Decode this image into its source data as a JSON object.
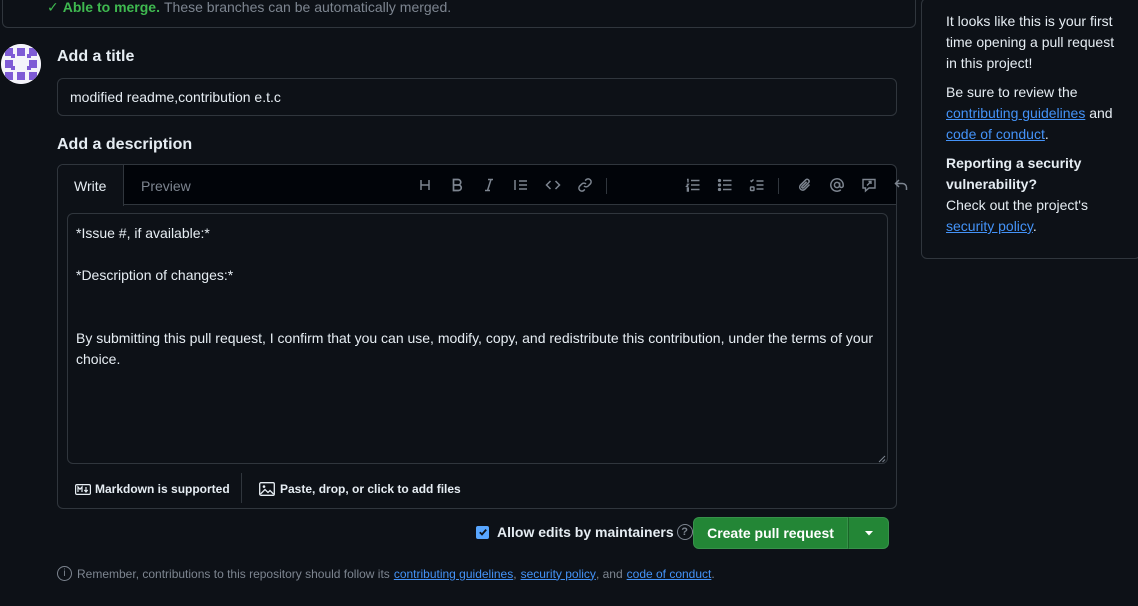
{
  "merge": {
    "status": "Able to merge.",
    "detail": "These branches can be automatically merged."
  },
  "form": {
    "title_label": "Add a title",
    "title_value": "modified readme,contribution e.t.c",
    "description_label": "Add a description"
  },
  "editor": {
    "tabs": [
      "Write",
      "Preview"
    ],
    "toolbar_icons": [
      "heading-icon",
      "bold-icon",
      "italic-icon",
      "quote-icon",
      "code-icon",
      "link-icon",
      "ordered-list-icon",
      "unordered-list-icon",
      "task-list-icon",
      "attach-icon",
      "mention-icon",
      "reference-icon",
      "undo-icon",
      "slash-command-icon"
    ],
    "body": "*Issue #, if available:*\n\n*Description of changes:*\n\n\nBy submitting this pull request, I confirm that you can use, modify, copy, and redistribute this contribution, under the terms of your choice.",
    "markdown_note": "Markdown is supported",
    "attach_note": "Paste, drop, or click to add files"
  },
  "actions": {
    "allow_edits_label": "Allow edits by maintainers",
    "allow_edits_checked": true,
    "create_label": "Create pull request"
  },
  "reminder": {
    "prefix": "Remember, contributions to this repository should follow its",
    "link1": "contributing guidelines",
    "sep1": ",",
    "link2": "security policy",
    "sep2": ", and",
    "link3": "code of conduct",
    "suffix": "."
  },
  "side_panel": {
    "intro": "It looks like this is your first time opening a pull request in this project!",
    "review_prefix": "Be sure to review the",
    "review_link1": "contributing guidelines",
    "review_and": "and",
    "review_link2": "code of conduct",
    "review_suffix": ".",
    "security_heading": "Reporting a security vulnerability?",
    "security_text": "Check out the project's",
    "security_link": "security policy",
    "security_suffix": "."
  },
  "colors": {
    "background": "#0d1117",
    "border": "#30363d",
    "accent_green": "#238636",
    "success_text": "#3fb950",
    "link": "#4493f8",
    "muted": "#7d8590"
  }
}
